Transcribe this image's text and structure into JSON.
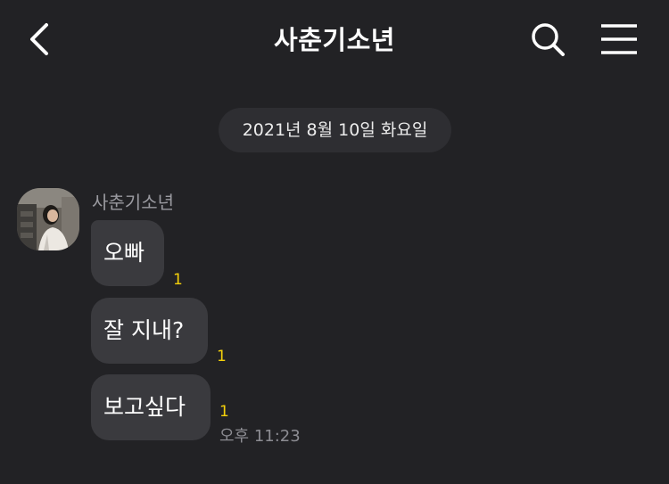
{
  "header": {
    "title": "사춘기소년",
    "back_icon": "chevron-left-icon",
    "search_icon": "search-icon",
    "menu_icon": "hamburger-menu-icon"
  },
  "date_divider": "2021년 8월 10일 화요일",
  "sender": {
    "name": "사춘기소년",
    "avatar": "profile-photo"
  },
  "messages": [
    {
      "text": "오빠",
      "unread": "1"
    },
    {
      "text": "잘 지내?",
      "unread": "1"
    },
    {
      "text": "보고싶다",
      "unread": "1"
    }
  ],
  "last_time": "오후 11:23",
  "colors": {
    "background": "#222225",
    "bubble": "#3a3a3e",
    "unread": "#f5d10a",
    "muted_text": "#9a9aa0"
  }
}
